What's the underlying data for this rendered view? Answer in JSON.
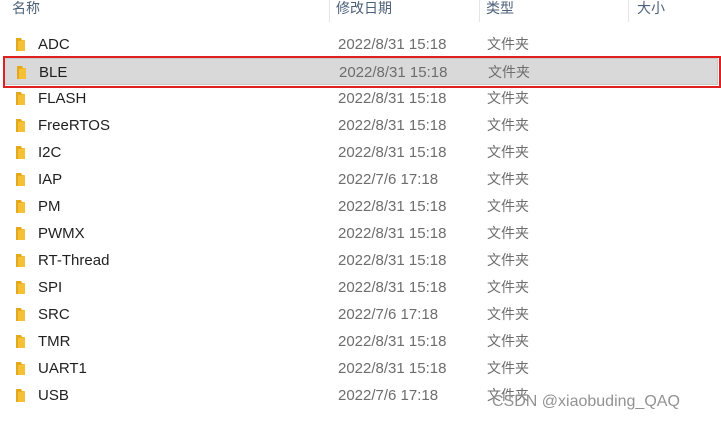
{
  "columns": {
    "name": "名称",
    "date": "修改日期",
    "type": "类型",
    "size": "大小"
  },
  "folder_icon": "folder-icon",
  "folder_color": "#f5c033",
  "selected_index": 1,
  "rows": [
    {
      "name": "ADC",
      "date": "2022/8/31 15:18",
      "type": "文件夹"
    },
    {
      "name": "BLE",
      "date": "2022/8/31 15:18",
      "type": "文件夹"
    },
    {
      "name": "FLASH",
      "date": "2022/8/31 15:18",
      "type": "文件夹"
    },
    {
      "name": "FreeRTOS",
      "date": "2022/8/31 15:18",
      "type": "文件夹"
    },
    {
      "name": "I2C",
      "date": "2022/8/31 15:18",
      "type": "文件夹"
    },
    {
      "name": "IAP",
      "date": "2022/7/6 17:18",
      "type": "文件夹"
    },
    {
      "name": "PM",
      "date": "2022/8/31 15:18",
      "type": "文件夹"
    },
    {
      "name": "PWMX",
      "date": "2022/8/31 15:18",
      "type": "文件夹"
    },
    {
      "name": "RT-Thread",
      "date": "2022/8/31 15:18",
      "type": "文件夹"
    },
    {
      "name": "SPI",
      "date": "2022/8/31 15:18",
      "type": "文件夹"
    },
    {
      "name": "SRC",
      "date": "2022/7/6 17:18",
      "type": "文件夹"
    },
    {
      "name": "TMR",
      "date": "2022/8/31 15:18",
      "type": "文件夹"
    },
    {
      "name": "UART1",
      "date": "2022/8/31 15:18",
      "type": "文件夹"
    },
    {
      "name": "USB",
      "date": "2022/7/6 17:18",
      "type": "文件夹"
    }
  ],
  "watermark": "CSDN @xiaobuding_QAQ",
  "highlight_color": "#e02020"
}
